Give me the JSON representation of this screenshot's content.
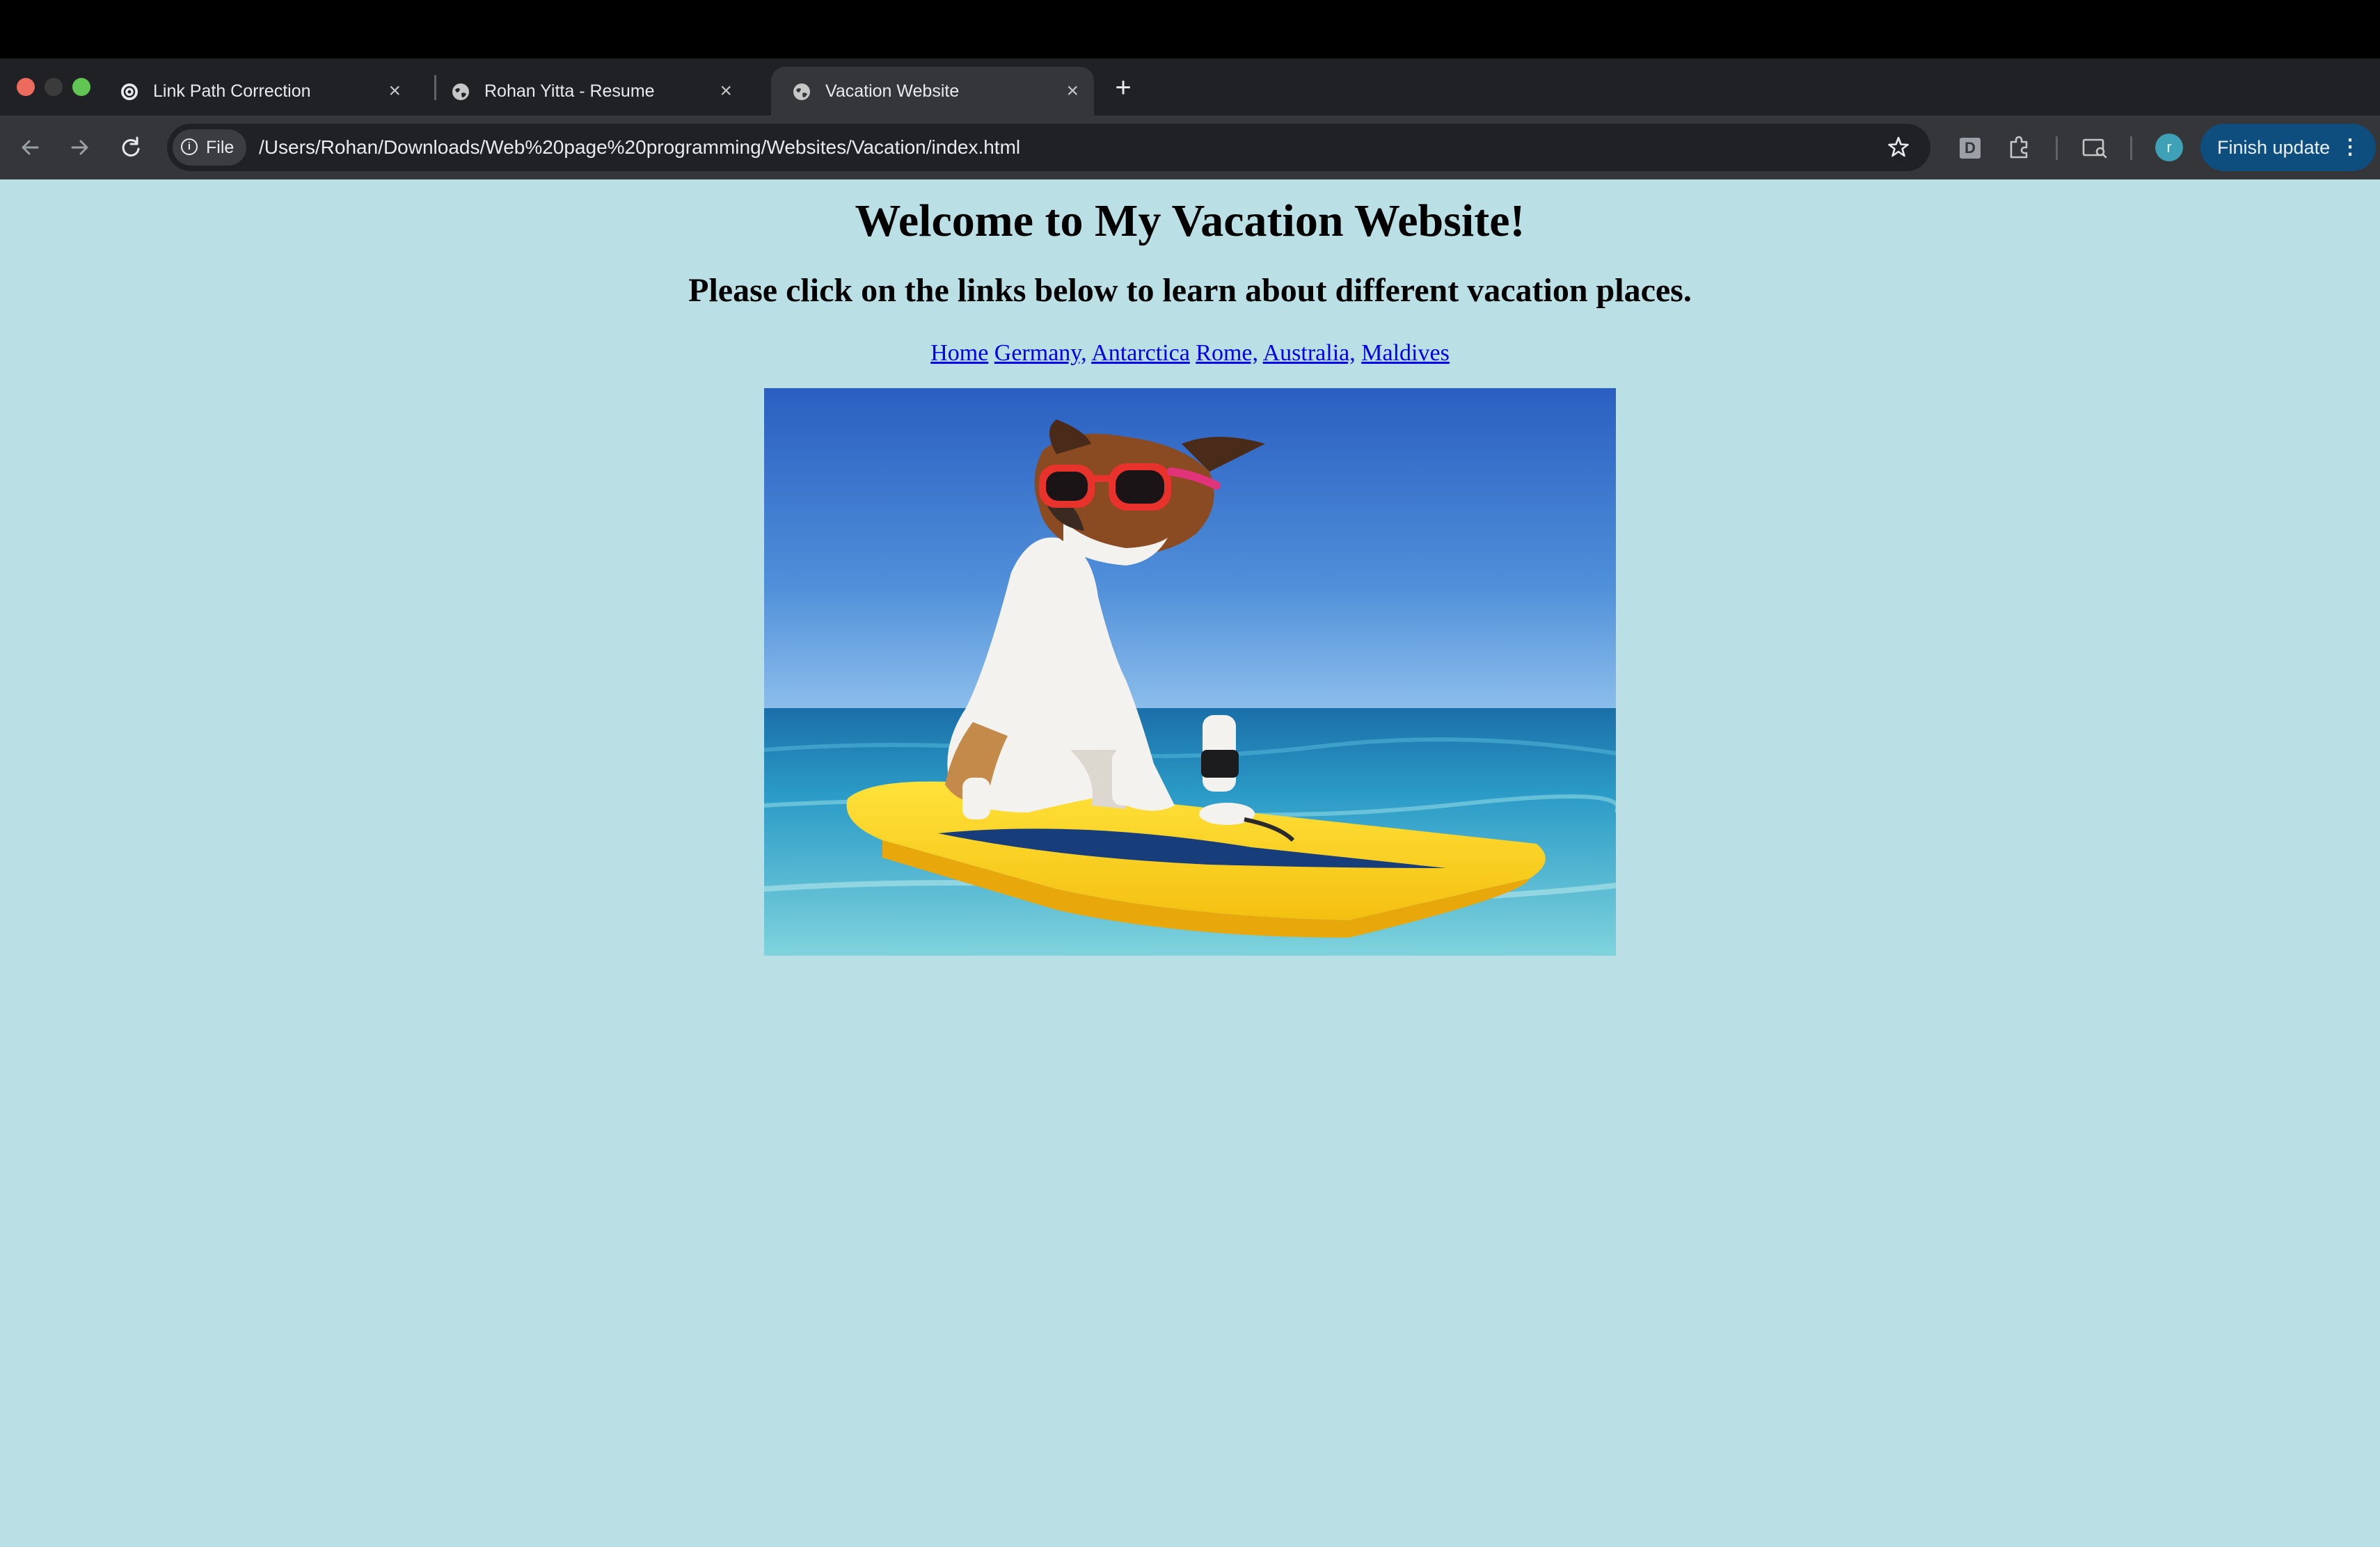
{
  "browser": {
    "tabs": [
      {
        "title": "Link Path Correction",
        "active": false,
        "favicon": "openai-icon"
      },
      {
        "title": "Rohan Yitta - Resume",
        "active": false,
        "favicon": "globe-icon"
      },
      {
        "title": "Vacation Website",
        "active": true,
        "favicon": "globe-icon"
      }
    ],
    "close_glyph": "×",
    "new_tab_glyph": "+",
    "address": {
      "chip_label": "File",
      "url": "/Users/Rohan/Downloads/Web%20page%20programming/Websites/Vacation/index.html"
    },
    "extension_badge": "D",
    "profile_initial": "r",
    "update_button_label": "Finish update",
    "menu_glyph": "⋮"
  },
  "page": {
    "heading": "Welcome to My Vacation Website!",
    "subheading": "Please click on the links below to learn about different vacation places.",
    "links": [
      {
        "label": "Home"
      },
      {
        "label": "Germany,"
      },
      {
        "label": "Antarctica"
      },
      {
        "label": "Rome,"
      },
      {
        "label": "Australia,"
      },
      {
        "label": "Maldives"
      }
    ],
    "background_color": "#bae0e5",
    "link_color": "#0000ee"
  }
}
